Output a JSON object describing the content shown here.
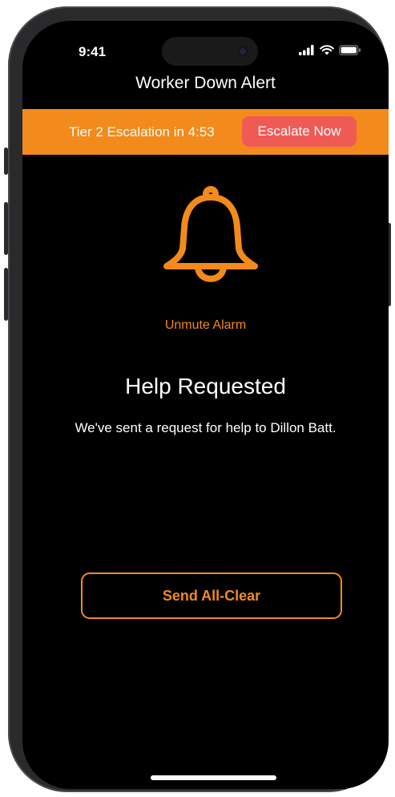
{
  "status_bar": {
    "time": "9:41",
    "icons": [
      "signal-icon",
      "wifi-icon",
      "battery-icon"
    ]
  },
  "nav": {
    "title": "Worker Down Alert"
  },
  "banner": {
    "text": "Tier 2 Escalation in 4:53",
    "button_label": "Escalate Now",
    "color": "#f28a1c",
    "button_color": "#f05a55"
  },
  "alarm": {
    "icon": "bell-icon",
    "unmute_label": "Unmute Alarm"
  },
  "content": {
    "heading": "Help Requested",
    "message": "We've sent a request for help to Dillon Batt."
  },
  "actions": {
    "all_clear_label": "Send All-Clear"
  },
  "colors": {
    "accent": "#f28a1c",
    "background": "#000000",
    "text": "#ffffff"
  }
}
